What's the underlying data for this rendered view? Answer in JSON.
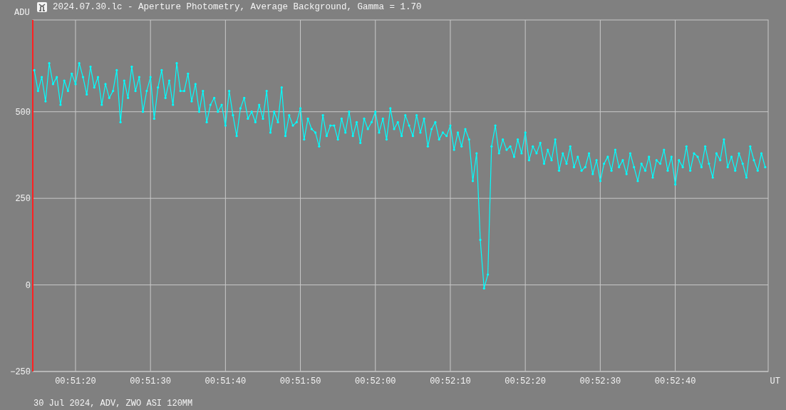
{
  "window": {
    "title": "2024.07.30.lc - Aperture Photometry, Average Background, Gamma = 1.70"
  },
  "plot": {
    "y_unit": "ADU",
    "x_unit": "UT",
    "footer": "30 Jul 2024, ADV, ZWO ASI 120MM",
    "chart_data": {
      "type": "line",
      "grid": true,
      "xlim": [
        3074.3,
        3172.4
      ],
      "ylim": [
        -250,
        765
      ],
      "yticks": [
        {
          "value": -250,
          "label": "−250"
        },
        0,
        250,
        500
      ],
      "xticks": [
        {
          "value": 3080,
          "label": "00:51:20"
        },
        {
          "value": 3090,
          "label": "00:51:30"
        },
        {
          "value": 3100,
          "label": "00:51:40"
        },
        {
          "value": 3110,
          "label": "00:51:50"
        },
        {
          "value": 3120,
          "label": "00:52:00"
        },
        {
          "value": 3130,
          "label": "00:52:10"
        },
        {
          "value": 3140,
          "label": "00:52:20"
        },
        {
          "value": 3150,
          "label": "00:52:30"
        },
        {
          "value": 3160,
          "label": "00:52:40"
        }
      ],
      "x": [
        3074.5,
        3075,
        3075.5,
        3076,
        3076.5,
        3077,
        3077.5,
        3078,
        3078.5,
        3079,
        3079.5,
        3080,
        3080.5,
        3081,
        3081.5,
        3082,
        3082.5,
        3083,
        3083.5,
        3084,
        3084.5,
        3085,
        3085.5,
        3086,
        3086.5,
        3087,
        3087.5,
        3088,
        3088.5,
        3089,
        3089.5,
        3090,
        3090.5,
        3091,
        3091.5,
        3092,
        3092.5,
        3093,
        3093.5,
        3094,
        3094.5,
        3095,
        3095.5,
        3096,
        3096.5,
        3097,
        3097.5,
        3098,
        3098.5,
        3099,
        3099.5,
        3100,
        3100.5,
        3101,
        3101.5,
        3102,
        3102.5,
        3103,
        3103.5,
        3104,
        3104.5,
        3105,
        3105.5,
        3106,
        3106.5,
        3107,
        3107.5,
        3108,
        3108.5,
        3109,
        3109.5,
        3110,
        3110.5,
        3111,
        3111.5,
        3112,
        3112.5,
        3113,
        3113.5,
        3114,
        3114.5,
        3115,
        3115.5,
        3116,
        3116.5,
        3117,
        3117.5,
        3118,
        3118.5,
        3119,
        3119.5,
        3120,
        3120.5,
        3121,
        3121.5,
        3122,
        3122.5,
        3123,
        3123.5,
        3124,
        3124.5,
        3125,
        3125.5,
        3126,
        3126.5,
        3127,
        3127.5,
        3128,
        3128.5,
        3129,
        3129.5,
        3130,
        3130.5,
        3131,
        3131.5,
        3132,
        3132.5,
        3133,
        3133.5,
        3134,
        3134.5,
        3135,
        3135.5,
        3136,
        3136.5,
        3137,
        3137.5,
        3138,
        3138.5,
        3139,
        3139.5,
        3140,
        3140.5,
        3141,
        3141.5,
        3142,
        3142.5,
        3143,
        3143.5,
        3144,
        3144.5,
        3145,
        3145.5,
        3146,
        3146.5,
        3147,
        3147.5,
        3148,
        3148.5,
        3149,
        3149.5,
        3150,
        3150.5,
        3151,
        3151.5,
        3152,
        3152.5,
        3153,
        3153.5,
        3154,
        3154.5,
        3155,
        3155.5,
        3156,
        3156.5,
        3157,
        3157.5,
        3158,
        3158.5,
        3159,
        3159.5,
        3160,
        3160.5,
        3161,
        3161.5,
        3162,
        3162.5,
        3163,
        3163.5,
        3164,
        3164.5,
        3165,
        3165.5,
        3166,
        3166.5,
        3167,
        3167.5,
        3168,
        3168.5,
        3169,
        3169.5,
        3170,
        3170.5,
        3171,
        3171.5,
        3172
      ],
      "series": [
        {
          "color": "#00ffff",
          "values": [
            620,
            560,
            600,
            530,
            640,
            580,
            600,
            520,
            590,
            560,
            610,
            580,
            640,
            600,
            550,
            630,
            570,
            600,
            520,
            580,
            540,
            560,
            620,
            470,
            590,
            540,
            630,
            560,
            600,
            500,
            560,
            600,
            480,
            570,
            620,
            540,
            590,
            520,
            640,
            560,
            560,
            610,
            530,
            580,
            500,
            560,
            470,
            520,
            540,
            500,
            520,
            460,
            560,
            490,
            430,
            510,
            540,
            480,
            500,
            470,
            520,
            480,
            560,
            440,
            500,
            470,
            570,
            430,
            490,
            460,
            470,
            510,
            420,
            480,
            450,
            440,
            400,
            490,
            430,
            460,
            460,
            420,
            480,
            440,
            500,
            430,
            470,
            410,
            480,
            450,
            470,
            500,
            440,
            480,
            420,
            510,
            450,
            470,
            430,
            490,
            460,
            430,
            490,
            440,
            480,
            400,
            450,
            470,
            420,
            440,
            430,
            460,
            390,
            440,
            400,
            450,
            420,
            300,
            380,
            130,
            -10,
            30,
            400,
            460,
            380,
            420,
            390,
            400,
            370,
            420,
            380,
            440,
            360,
            400,
            380,
            410,
            350,
            390,
            360,
            420,
            330,
            380,
            350,
            400,
            340,
            370,
            330,
            340,
            380,
            320,
            360,
            300,
            350,
            370,
            330,
            390,
            340,
            360,
            320,
            380,
            340,
            300,
            350,
            330,
            370,
            310,
            360,
            350,
            390,
            330,
            370,
            290,
            360,
            340,
            400,
            330,
            380,
            370,
            340,
            400,
            350,
            310,
            380,
            360,
            420,
            340,
            370,
            330,
            380,
            350,
            310,
            400,
            360,
            330,
            380,
            340
          ]
        }
      ]
    }
  }
}
